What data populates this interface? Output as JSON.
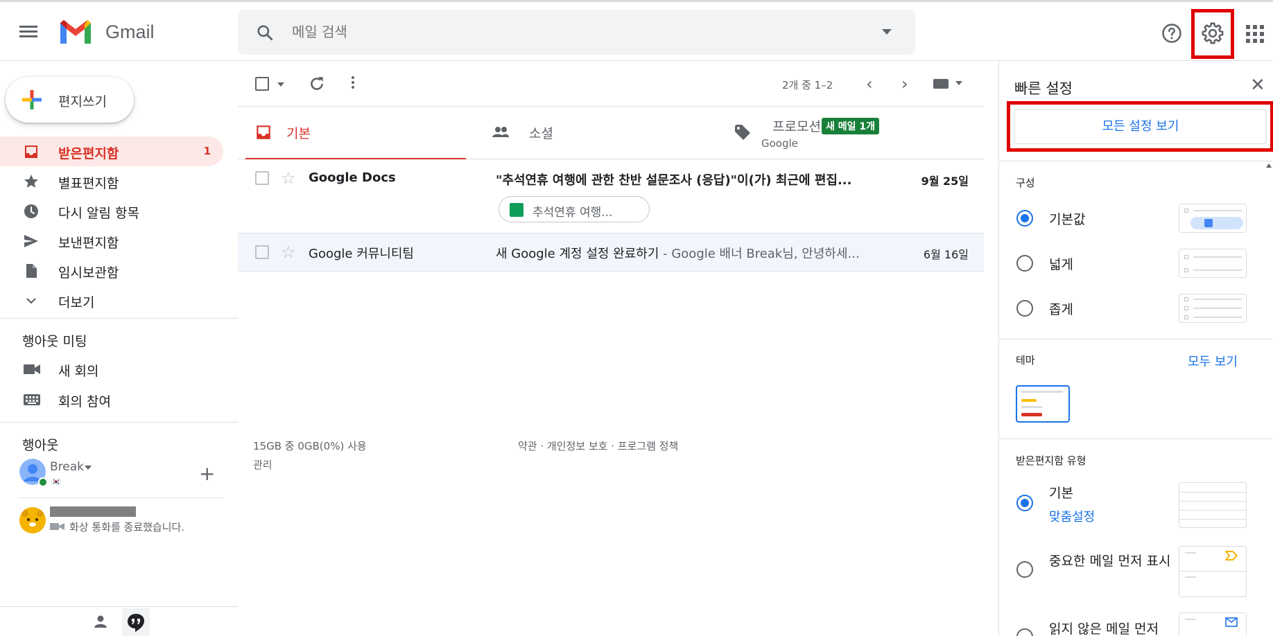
{
  "app": {
    "logo_text": "Gmail"
  },
  "search": {
    "placeholder": "메일 검색"
  },
  "header": {
    "settings_tooltip": "설정"
  },
  "compose": {
    "label": "편지쓰기"
  },
  "sidebar": {
    "items": [
      {
        "label": "받은편지함",
        "count": "1",
        "icon": "inbox-icon"
      },
      {
        "label": "별표편지함",
        "count": "",
        "icon": "star-icon"
      },
      {
        "label": "다시 알림 항목",
        "count": "",
        "icon": "clock-icon"
      },
      {
        "label": "보낸편지함",
        "count": "",
        "icon": "send-icon"
      },
      {
        "label": "임시보관함",
        "count": "",
        "icon": "draft-icon"
      },
      {
        "label": "더보기",
        "count": "",
        "icon": "chevron-down-icon"
      }
    ],
    "meet_title": "행아웃 미팅",
    "meet_items": [
      {
        "label": "새 회의",
        "icon": "video-camera-icon"
      },
      {
        "label": "회의 참여",
        "icon": "keyboard-icon"
      }
    ],
    "hangouts_title": "행아웃",
    "hangouts_user": "Break",
    "hangouts_flag": "🇰🇷",
    "contact_status": "화상 통화를 종료했습니다."
  },
  "toolbar": {
    "pagination": "2개 중 1–2"
  },
  "tabs": [
    {
      "label": "기본",
      "active": true
    },
    {
      "label": "소셜",
      "active": false
    },
    {
      "label": "프로모션",
      "active": false,
      "badge": "새 메일 1개",
      "sub": "Google"
    }
  ],
  "emails": [
    {
      "sender": "Google Docs",
      "subject": "\"추석연휴 여행에 관한 찬반 설문조사 (응답)\"이(가) 최근에 편집...",
      "snippet": "",
      "date": "9월 25일",
      "unread": true,
      "attachment": "추석연휴 여행..."
    },
    {
      "sender": "Google 커뮤니티팀",
      "subject": "새 Google 계정 설정 완료하기",
      "snippet": " - Google 배너 Break님, 안녕하세...",
      "date": "6월 16일",
      "unread": false,
      "attachment": ""
    }
  ],
  "footer": {
    "storage": "15GB 중 0GB(0%) 사용",
    "manage": "관리",
    "links": "약관 · 개인정보 보호 · 프로그램 정책"
  },
  "quick_settings": {
    "title": "빠른 설정",
    "all_settings_button": "모든 설정 보기",
    "density_title": "구성",
    "density_options": [
      {
        "label": "기본값",
        "selected": true
      },
      {
        "label": "넓게",
        "selected": false
      },
      {
        "label": "좁게",
        "selected": false
      }
    ],
    "theme_title": "테마",
    "theme_view_all": "모두 보기",
    "inbox_type_title": "받은편지함 유형",
    "inbox_types": [
      {
        "label": "기본",
        "selected": true,
        "link": "맞춤설정"
      },
      {
        "label": "중요한 메일 먼저 표시",
        "selected": false
      },
      {
        "label": "읽지 않은 메일 먼저",
        "selected": false
      }
    ]
  },
  "colors": {
    "accent_red": "#d93025",
    "link_blue": "#1a73e8",
    "highlight_red": "#e00000",
    "promo_green": "#188038"
  }
}
